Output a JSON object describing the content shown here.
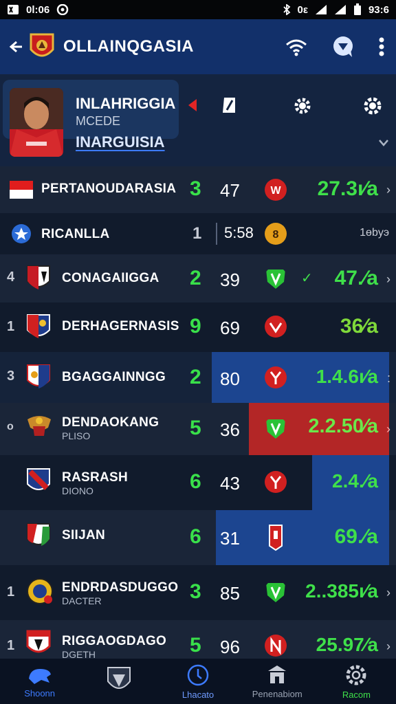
{
  "status_bar": {
    "left_icons": [
      "app-notification-icon",
      "message-icon",
      "camera-icon"
    ],
    "left_text": "0l:06",
    "right_text": "0ε",
    "time": "93:6"
  },
  "header": {
    "title": "OLLAINQGASIA",
    "back_icon": "back-arrow-icon",
    "actions": [
      "wifi-icon",
      "chat-icon",
      "more-vert-icon"
    ]
  },
  "profile": {
    "name": "INLAHRIGGIA",
    "subtitle": "MCEDE",
    "link": "INARGUISIA"
  },
  "rows": [
    {
      "rank": "",
      "team": "PERTANOUDARASIA",
      "sub": "",
      "n1": "3",
      "n2": "47",
      "val": "27.3ı∕а",
      "flag": "indonesia-flag-icon",
      "badge": "w"
    },
    {
      "rank": "",
      "team": "RICANLLA",
      "sub": "",
      "n1": "1",
      "n2": "5:58",
      "val": "1өbyэ",
      "flag": "star-crest-icon",
      "badge": "8"
    },
    {
      "rank": "4",
      "team": "CONAGAIIGGA",
      "sub": "",
      "n1": "2",
      "n2": "39",
      "val": "47.∕а",
      "flag": "club-crest-icon",
      "badge": "v"
    },
    {
      "rank": "1",
      "team": "DERHAGERNASIS",
      "sub": "",
      "n1": "9",
      "n2": "69",
      "val": "36∕а",
      "flag": "club-crest-icon",
      "badge": "v"
    },
    {
      "rank": "3",
      "team": "BGAGGAINNGG",
      "sub": "",
      "n1": "2",
      "n2": "80",
      "val": "1.4.6ı∕а",
      "flag": "club-crest-icon",
      "badge": "y"
    },
    {
      "rank": "o",
      "team": "DENDAOKANG",
      "sub": "PLISO",
      "n1": "5",
      "n2": "36",
      "val": "2.2.50∕а",
      "flag": "garuda-crest-icon",
      "badge": "v"
    },
    {
      "rank": "",
      "team": "RASRASH",
      "sub": "DIONO",
      "n1": "6",
      "n2": "43",
      "val": "2.4.∕а",
      "flag": "club-crest-icon",
      "badge": "y"
    },
    {
      "rank": "",
      "team": "SIIJAN",
      "sub": "",
      "n1": "6",
      "n2": "31",
      "val": "69.∕а",
      "flag": "club-crest-icon",
      "badge": "shirt"
    },
    {
      "rank": "1",
      "team": "ENDRDASDUGGO",
      "sub": "DACTER",
      "n1": "3",
      "n2": "85",
      "val": "2..385ı∕а",
      "flag": "club-crest-icon",
      "badge": "v"
    },
    {
      "rank": "1",
      "team": "RIGGAOGDAGO",
      "sub": "DGETH",
      "n1": "5",
      "n2": "96",
      "val": "25.97∕а",
      "flag": "club-crest-icon",
      "badge": "n"
    }
  ],
  "nav": [
    {
      "label": "Shoonn",
      "icon": "lion-icon",
      "active": true
    },
    {
      "label": "",
      "icon": "shield-crest-icon",
      "active": false
    },
    {
      "label": "Lhacato",
      "icon": "clock-icon",
      "active": false
    },
    {
      "label": "Penenabiom",
      "icon": "building-icon",
      "active": false
    },
    {
      "label": "Racom",
      "icon": "gear-icon",
      "active": false
    }
  ],
  "colors": {
    "app_bar": "#12306a",
    "green": "#3fe04a",
    "highlight_blue": "#1c4590",
    "highlight_red": "#b32626"
  }
}
